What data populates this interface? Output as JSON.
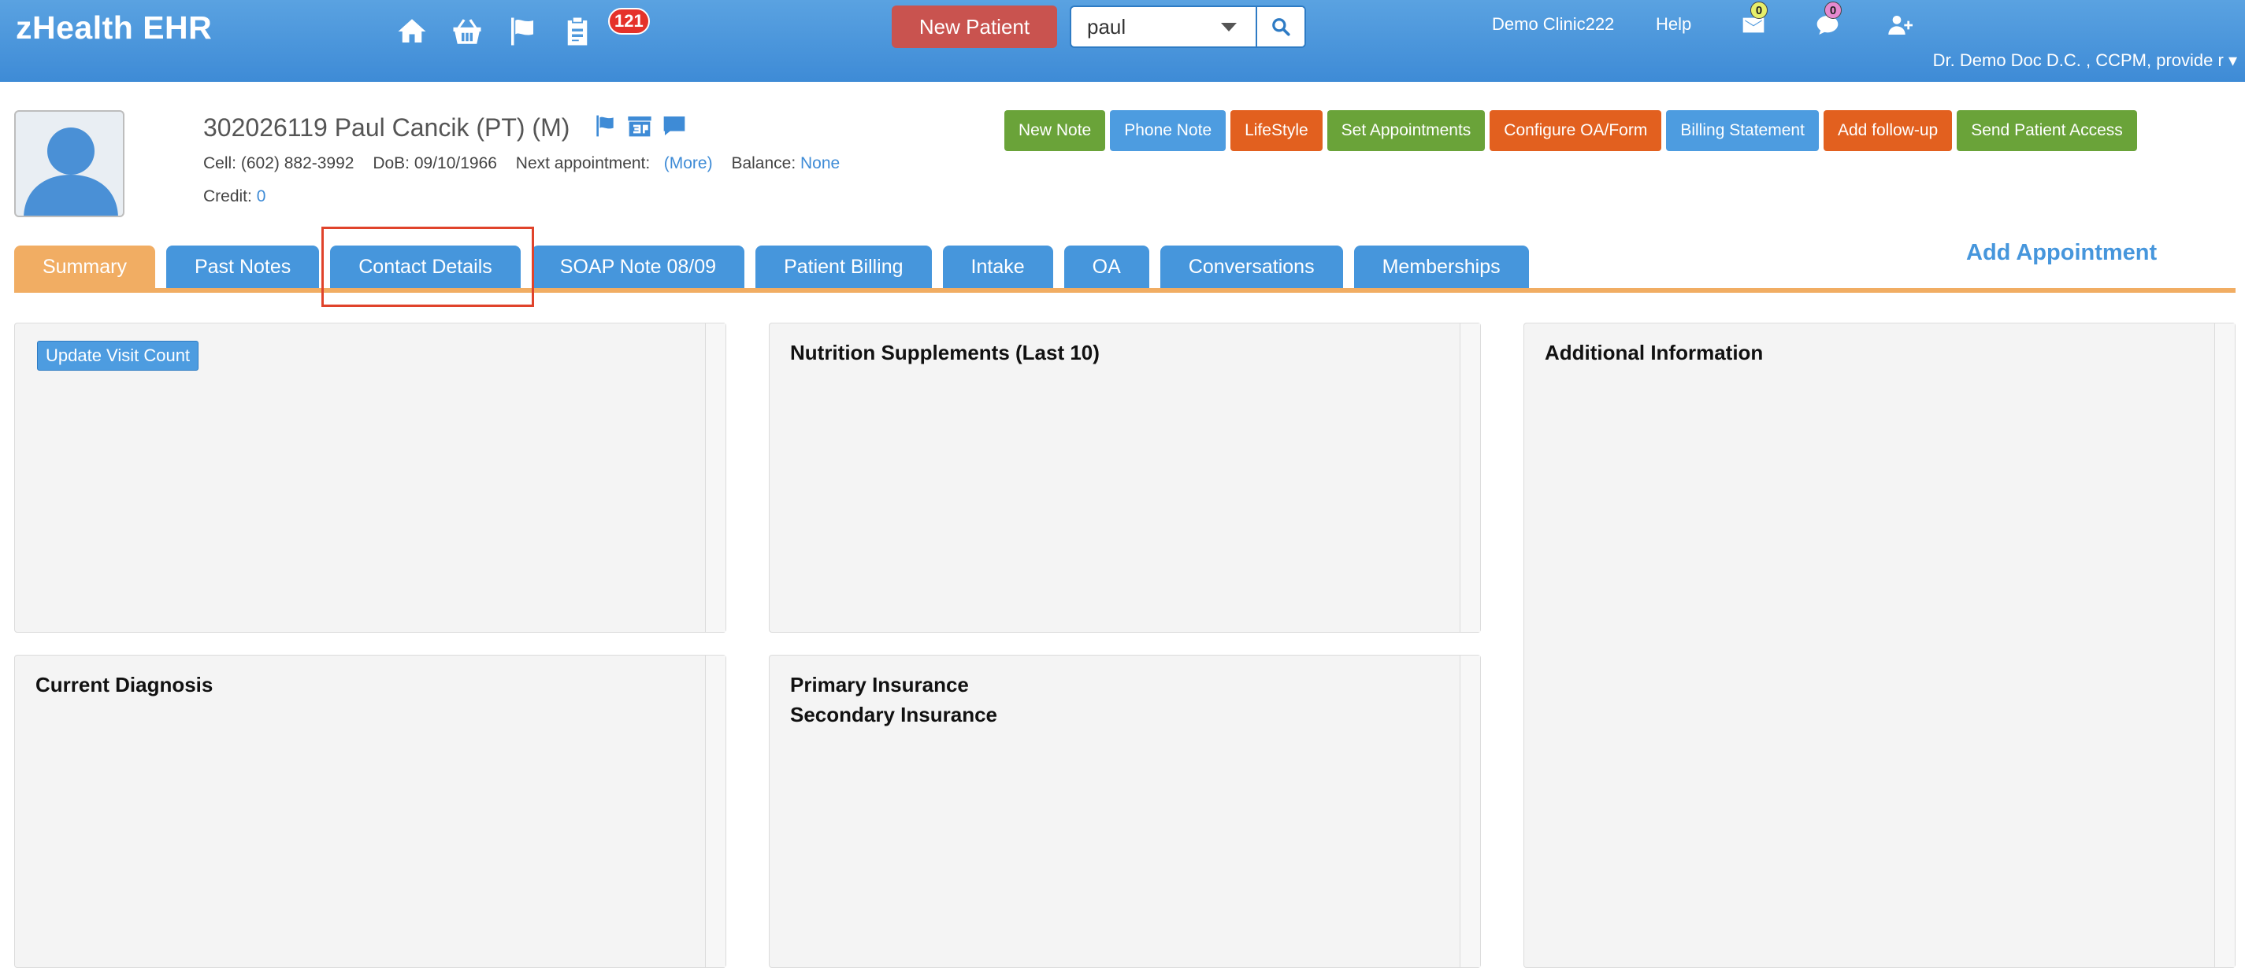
{
  "app": {
    "title": "zHealth EHR"
  },
  "header": {
    "icons": [
      "home-icon",
      "basket-icon",
      "flag-icon",
      "clipboard-icon"
    ],
    "notification_count": "121",
    "new_patient_label": "New Patient",
    "search": {
      "value": "paul"
    },
    "clinic": "Demo Clinic222",
    "help": "Help",
    "mail_count": "0",
    "chat_count": "0",
    "user": "Dr. Demo Doc D.C. , CCPM, provide r"
  },
  "patient": {
    "title": "302026119 Paul Cancik  (PT) (M)",
    "cell_label": "Cell:",
    "cell": "(602) 882-3992",
    "dob_label": "DoB:",
    "dob": "09/10/1966",
    "next_appt_label": "Next appointment:",
    "next_appt_link": "(More)",
    "balance_label": "Balance:",
    "balance": "None",
    "credit_label": "Credit:",
    "credit": "0"
  },
  "actions": [
    {
      "label": "New Note",
      "color": "#6aa339"
    },
    {
      "label": "Phone Note",
      "color": "#4d9ce0"
    },
    {
      "label": "LifeStyle",
      "color": "#e2601f"
    },
    {
      "label": "Set Appointments",
      "color": "#6aa339"
    },
    {
      "label": "Configure OA/Form",
      "color": "#e2601f"
    },
    {
      "label": "Billing Statement",
      "color": "#4d9ce0"
    },
    {
      "label": "Add follow-up",
      "color": "#e2601f"
    },
    {
      "label": "Send Patient Access",
      "color": "#6aa339"
    }
  ],
  "tabs": [
    {
      "label": "Summary",
      "active": true
    },
    {
      "label": "Past Notes"
    },
    {
      "label": "Contact Details"
    },
    {
      "label": "SOAP Note 08/09"
    },
    {
      "label": "Patient Billing"
    },
    {
      "label": "Intake"
    },
    {
      "label": "OA"
    },
    {
      "label": "Conversations"
    },
    {
      "label": "Memberships"
    }
  ],
  "add_appointment": "Add Appointment",
  "panels": {
    "visit": {
      "button": "Update Visit Count"
    },
    "nutrition": {
      "title": "Nutrition Supplements (Last 10)"
    },
    "additional": {
      "title": "Additional Information"
    },
    "diagnosis": {
      "title": "Current Diagnosis"
    },
    "insurance": {
      "primary": "Primary Insurance",
      "secondary": "Secondary Insurance"
    }
  },
  "colors": {
    "header": "#3e8bd6",
    "tab": "#4696dc",
    "tab_active": "#f1ad63",
    "highlight": "#e0432b"
  }
}
